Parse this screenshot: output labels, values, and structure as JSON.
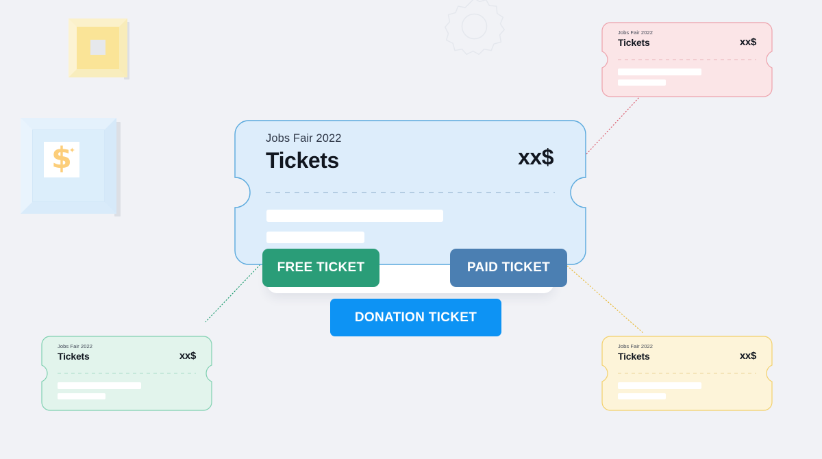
{
  "page": {
    "background_color": "#f1f2f6",
    "title": "Ticket types diagram"
  },
  "main_ticket": {
    "eyebrow": "Jobs Fair 2022",
    "title": "Tickets",
    "price": "xx$",
    "fill_color": "#ddedfb",
    "border_color": "#5aa9dd"
  },
  "buttons": [
    {
      "id": "free",
      "label": "FREE TICKET",
      "color": "#2a9d78"
    },
    {
      "id": "paid",
      "label": "PAID TICKET",
      "color": "#4b7fb2"
    },
    {
      "id": "donation",
      "label": "DONATION TICKET",
      "color": "#0d93f4"
    }
  ],
  "mini_tickets": [
    {
      "id": "pink",
      "eyebrow": "Jobs Fair 2022",
      "title": "Tickets",
      "price": "xx$",
      "fill_color": "#fbe5e7",
      "border_color": "#eda1ab",
      "connector_color": "#d84a5c"
    },
    {
      "id": "green",
      "eyebrow": "Jobs Fair 2022",
      "title": "Tickets",
      "price": "xx$",
      "fill_color": "#e2f4ec",
      "border_color": "#7fd0b0",
      "connector_color": "#1d9c6f"
    },
    {
      "id": "yellow",
      "eyebrow": "Jobs Fair 2022",
      "title": "Tickets",
      "price": "xx$",
      "fill_color": "#fdf4d9",
      "border_color": "#f2d06a",
      "connector_color": "#e8b62c"
    }
  ],
  "decorations": {
    "gear": {
      "name": "gear-outline",
      "color": "#e7e9ee"
    },
    "square_frame": {
      "name": "yellow-square-frame",
      "color": "#fae497"
    },
    "money_frame": {
      "name": "dollar-picture-frame",
      "symbol": "$",
      "color": "#fcce7a"
    }
  }
}
